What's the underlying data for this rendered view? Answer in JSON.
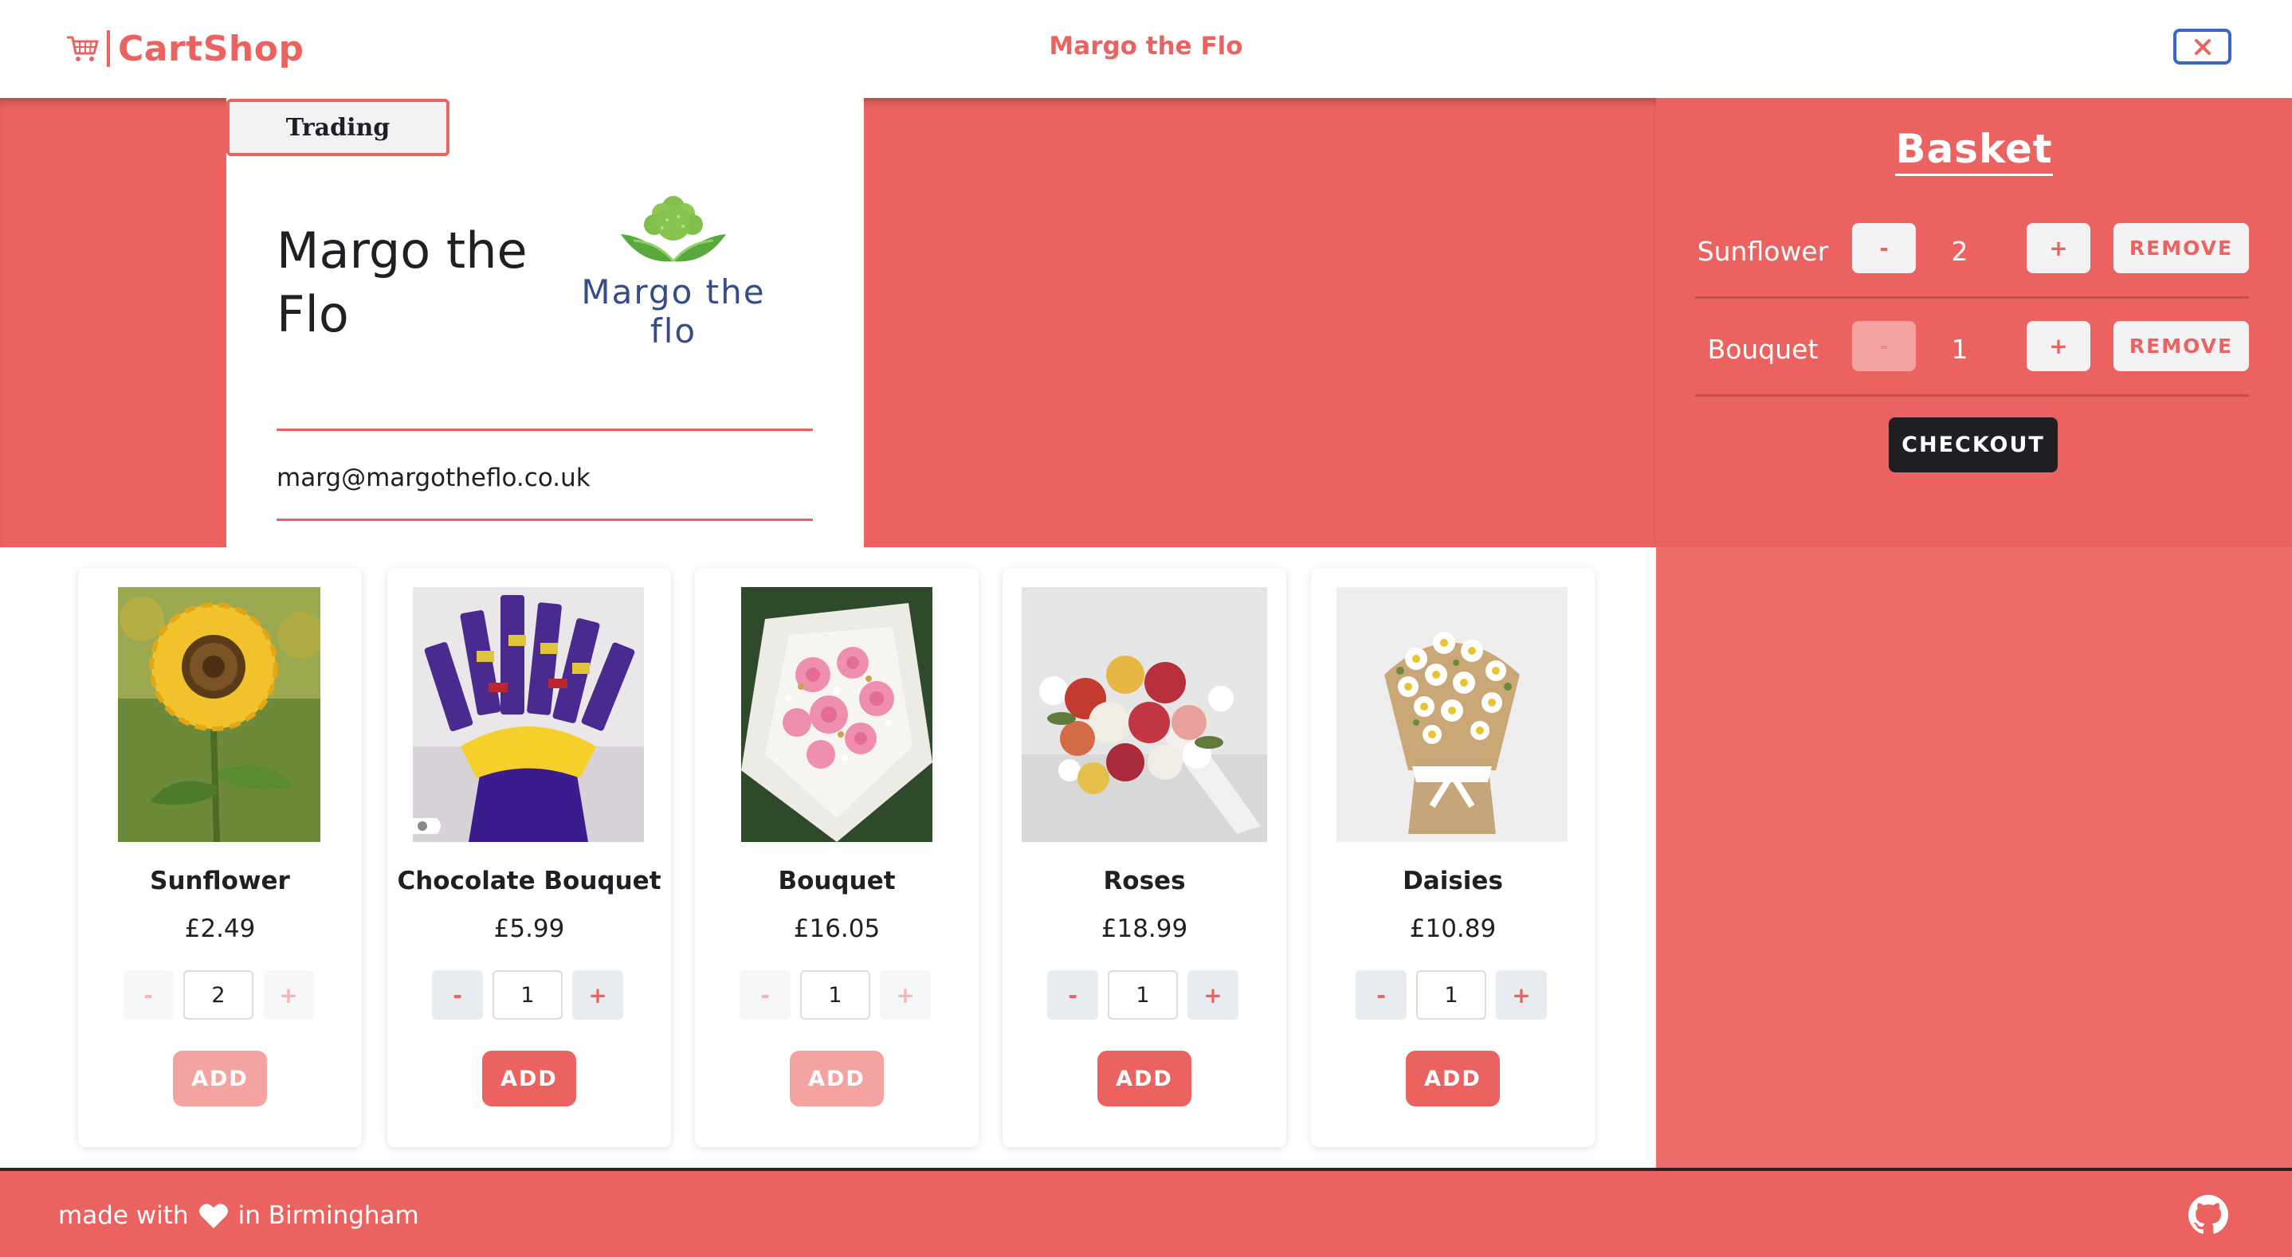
{
  "header": {
    "brand": "CartShop",
    "title": "Margo the Flo",
    "close_icon": "close-icon",
    "brand_color": "#eb6360"
  },
  "shop": {
    "status": "Trading",
    "name": "Margo the Flo",
    "logo_text": "Margo the flo",
    "email": "marg@margotheflo.co.uk"
  },
  "basket": {
    "title": "Basket",
    "items": [
      {
        "name": "Sunflower",
        "qty": "2",
        "minus": "-",
        "plus": "+",
        "remove": "REMOVE",
        "minus_disabled": false
      },
      {
        "name": "Bouquet",
        "qty": "1",
        "minus": "-",
        "plus": "+",
        "remove": "REMOVE",
        "minus_disabled": true
      }
    ],
    "checkout": "CHECKOUT"
  },
  "products": [
    {
      "name": "Sunflower",
      "price": "£2.49",
      "qty": "2",
      "minus": "-",
      "plus": "+",
      "add": "ADD",
      "disabled": true
    },
    {
      "name": "Chocolate Bouquet",
      "price": "£5.99",
      "qty": "1",
      "minus": "-",
      "plus": "+",
      "add": "ADD",
      "disabled": false
    },
    {
      "name": "Bouquet",
      "price": "£16.05",
      "qty": "1",
      "minus": "-",
      "plus": "+",
      "add": "ADD",
      "disabled": true
    },
    {
      "name": "Roses",
      "price": "£18.99",
      "qty": "1",
      "minus": "-",
      "plus": "+",
      "add": "ADD",
      "disabled": false
    },
    {
      "name": "Daisies",
      "price": "£10.89",
      "qty": "1",
      "minus": "-",
      "plus": "+",
      "add": "ADD",
      "disabled": false
    }
  ],
  "footer": {
    "made_with": "made with",
    "location": "in Birmingham",
    "heart_icon": "heart-icon",
    "github_icon": "github-icon"
  },
  "colors": {
    "accent": "#eb6360",
    "dark": "#1f1f24",
    "close_border": "#3867c4"
  }
}
